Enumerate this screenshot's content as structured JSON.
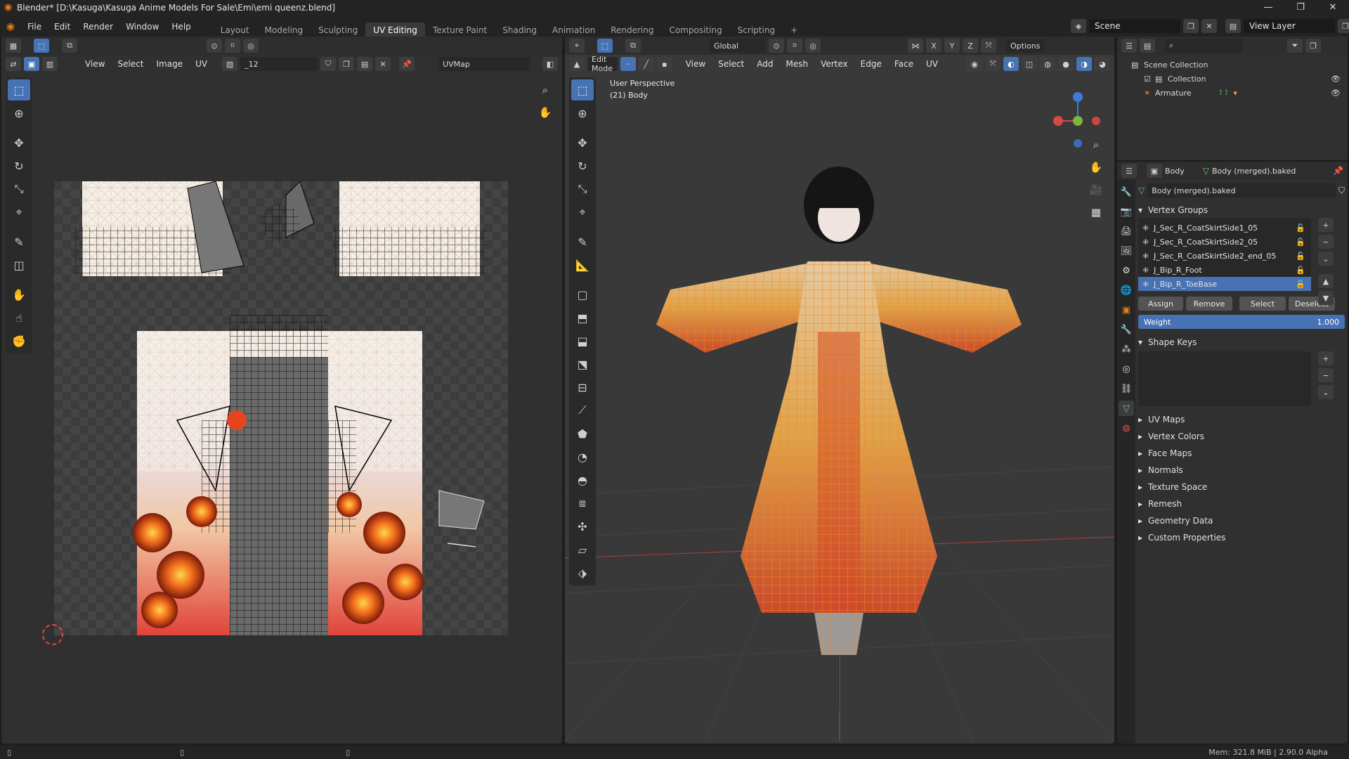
{
  "window": {
    "title": "Blender* [D:\\Kasuga\\Kasuga Anime Models For Sale\\Emi\\emi queenz.blend]",
    "minimize": "—",
    "maximize": "❐",
    "close": "✕"
  },
  "menu": [
    "File",
    "Edit",
    "Render",
    "Window",
    "Help"
  ],
  "workspaces": [
    "Layout",
    "Modeling",
    "Sculpting",
    "UV Editing",
    "Texture Paint",
    "Shading",
    "Animation",
    "Rendering",
    "Compositing",
    "Scripting"
  ],
  "active_workspace": "UV Editing",
  "add_workspace": "+",
  "scene": {
    "label": "Scene",
    "view_layer": "View Layer"
  },
  "uv_editor": {
    "menus": [
      "View",
      "Select",
      "Image",
      "UV"
    ],
    "image_name": "_12",
    "uvmap": "UVMap"
  },
  "viewport": {
    "mode": "Edit Mode",
    "menus": [
      "View",
      "Select",
      "Add",
      "Mesh",
      "Vertex",
      "Edge",
      "Face",
      "UV"
    ],
    "orientation": "Global",
    "options_label": "Options",
    "info_line1": "User Perspective",
    "info_line2": "(21) Body",
    "axis_x": "X",
    "axis_y": "Y",
    "axis_z": "Z"
  },
  "outliner": {
    "search_placeholder": "",
    "rows": [
      "Scene Collection",
      "Collection",
      "Armature"
    ]
  },
  "properties": {
    "object_name": "Body",
    "data_name": "Body (merged).baked",
    "mesh_field": "Body (merged).baked",
    "vertex_groups_title": "Vertex Groups",
    "vertex_groups": [
      "J_Sec_R_CoatSkirtSide1_05",
      "J_Sec_R_CoatSkirtSide2_05",
      "J_Sec_R_CoatSkirtSide2_end_05",
      "J_Bip_R_Foot",
      "J_Bip_R_ToeBase"
    ],
    "selected_group": "J_Bip_R_ToeBase",
    "buttons": [
      "Assign",
      "Remove",
      "Select",
      "Deselect"
    ],
    "weight_label": "Weight",
    "weight_value": "1.000",
    "shape_keys_title": "Shape Keys",
    "collapsed_panels": [
      "UV Maps",
      "Vertex Colors",
      "Face Maps",
      "Normals",
      "Texture Space",
      "Remesh",
      "Geometry Data",
      "Custom Properties"
    ]
  },
  "status": {
    "memory": "Mem: 321.8 MiB | 2.90.0 Alpha"
  },
  "colors": {
    "accent": "#4772b3",
    "mesh_orange": "#f08a1c",
    "bg": "#303030"
  }
}
